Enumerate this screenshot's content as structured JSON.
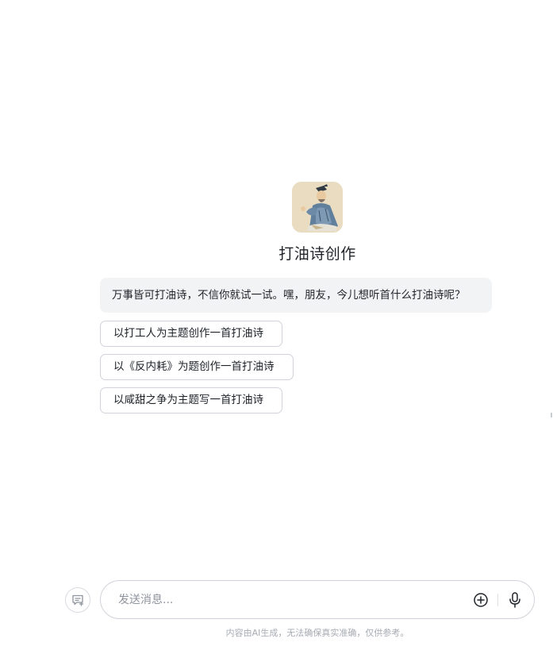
{
  "bot": {
    "name": "打油诗创作",
    "avatar": "scholar-portrait-avatar",
    "greeting": "万事皆可打油诗，不信你就试一试。嘿，朋友，今儿想听首什么打油诗呢？"
  },
  "suggestions": [
    "以打工人为主题创作一首打油诗",
    "以《反内耗》为题创作一首打油诗",
    "以咸甜之争为主题写一首打油诗"
  ],
  "composer": {
    "placeholder": "发送消息...",
    "new_chat_icon": "new-chat-icon",
    "attach_icon": "plus-circle-icon",
    "mic_icon": "microphone-icon"
  },
  "footer": {
    "disclaimer": "内容由AI生成，无法确保真实准确，仅供参考。"
  }
}
